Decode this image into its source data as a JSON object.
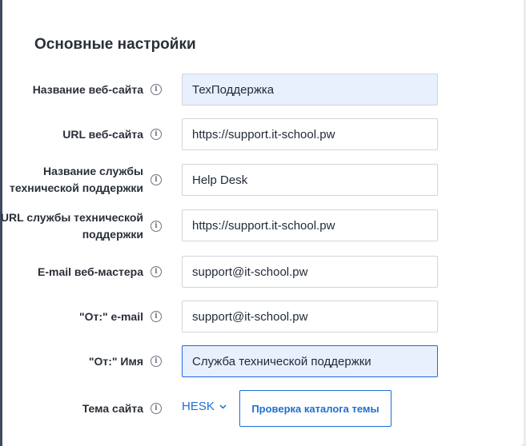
{
  "section": {
    "title": "Основные настройки"
  },
  "fields": [
    {
      "label": "Название веб-сайта",
      "value": "ТехПоддержка"
    },
    {
      "label": "URL веб-сайта",
      "value": "https://support.it-school.pw"
    },
    {
      "label_line1": "Название службы",
      "label_line2": "технической поддержки",
      "value": "Help Desk"
    },
    {
      "label_line1": "URL службы технической",
      "label_line2": "поддержки",
      "value": "https://support.it-school.pw"
    },
    {
      "label": "E-mail веб-мастера",
      "value": "support@it-school.pw"
    },
    {
      "label": "\"От:\" e-mail",
      "value": "support@it-school.pw"
    },
    {
      "label": "\"От:\" Имя",
      "value": "Служба технической поддержки"
    }
  ],
  "theme": {
    "label": "Тема сайта",
    "selected": "HESK",
    "check_button": "Проверка каталога темы"
  },
  "icons": {
    "info": "info-icon",
    "dropdown": "chevron-down-icon"
  },
  "colors": {
    "accent": "#1f6fd1",
    "focus_border": "#2563eb",
    "autofill_bg": "#e8f0fe"
  }
}
